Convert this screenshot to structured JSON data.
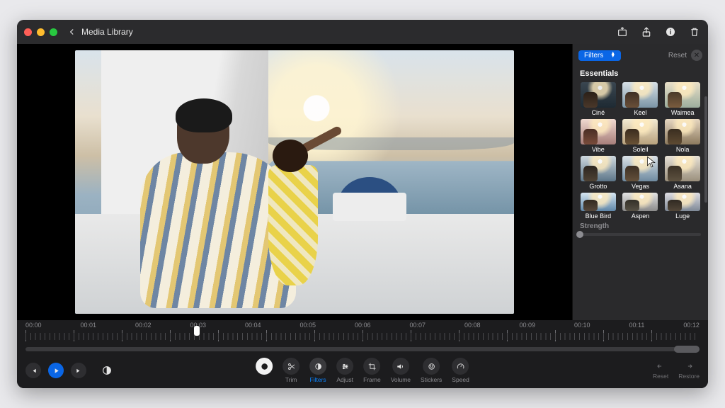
{
  "window": {
    "title": "Media Library"
  },
  "titlebar": {
    "icons": [
      "add-media",
      "share",
      "info",
      "trash"
    ]
  },
  "inspector": {
    "menu_label": "Filters",
    "reset_label": "Reset",
    "section_title": "Essentials",
    "strength_label": "Strength",
    "filters": [
      {
        "name": "Ciné",
        "sky1": "#3a4650",
        "sky2": "#1e2a33",
        "p1": "#2b2018",
        "p2": "#4a382a"
      },
      {
        "name": "Keel",
        "sky1": "#d7e0e6",
        "sky2": "#7b95a6",
        "p1": "#3f3026",
        "p2": "#6a4f38"
      },
      {
        "name": "Waimea",
        "sky1": "#e9dfc8",
        "sky2": "#9cae9d",
        "p1": "#4a3a2a",
        "p2": "#7a5c3e"
      },
      {
        "name": "Vibe",
        "sky1": "#f0d9d0",
        "sky2": "#a77e7a",
        "p1": "#4a2e24",
        "p2": "#7a4c3a"
      },
      {
        "name": "Soleil",
        "sky1": "#f3ead2",
        "sky2": "#b9a27d",
        "p1": "#3a2c1e",
        "p2": "#6a5236"
      },
      {
        "name": "Nola",
        "sky1": "#e6d6c0",
        "sky2": "#8c7a5e",
        "p1": "#3a2e20",
        "p2": "#5e4a32"
      },
      {
        "name": "Grotto",
        "sky1": "#cfd9df",
        "sky2": "#5c7588",
        "p1": "#2c2620",
        "p2": "#4e4234"
      },
      {
        "name": "Vegas",
        "sky1": "#dce3e8",
        "sky2": "#6e8aa0",
        "p1": "#3d3024",
        "p2": "#64503a"
      },
      {
        "name": "Asana",
        "sky1": "#e7e1d6",
        "sky2": "#9a8f7c",
        "p1": "#3c3226",
        "p2": "#5e5240"
      },
      {
        "name": "Blue Bird",
        "sky1": "#d6e6f2",
        "sky2": "#5e86a8",
        "p1": "#332a20",
        "p2": "#55473a"
      },
      {
        "name": "Aspen",
        "sky1": "#e3e3e3",
        "sky2": "#8a8a8a",
        "p1": "#333028",
        "p2": "#565044"
      },
      {
        "name": "Luge",
        "sky1": "#dedde2",
        "sky2": "#7e8896",
        "p1": "#302a22",
        "p2": "#524638"
      }
    ]
  },
  "timeline": {
    "marks": [
      "00:00",
      "00:01",
      "00:02",
      "00:03",
      "00:04",
      "00:05",
      "00:06",
      "00:07",
      "00:08",
      "00:09",
      "00:10",
      "00:11",
      "00:12"
    ],
    "playhead_index": 3
  },
  "toolbar": {
    "tools": [
      {
        "key": "exposure",
        "label": "",
        "icon": "exposure",
        "style": "white"
      },
      {
        "key": "trim",
        "label": "Trim",
        "icon": "scissors"
      },
      {
        "key": "filters",
        "label": "Filters",
        "icon": "contrast",
        "active": true
      },
      {
        "key": "adjust",
        "label": "Adjust",
        "icon": "sliders"
      },
      {
        "key": "frame",
        "label": "Frame",
        "icon": "crop"
      },
      {
        "key": "volume",
        "label": "Volume",
        "icon": "speaker"
      },
      {
        "key": "stickers",
        "label": "Stickers",
        "icon": "sticker"
      },
      {
        "key": "speed",
        "label": "Speed",
        "icon": "gauge"
      }
    ],
    "right": [
      {
        "key": "reset",
        "label": "Reset",
        "icon": "undo"
      },
      {
        "key": "restore",
        "label": "Restore",
        "icon": "redo"
      }
    ]
  }
}
